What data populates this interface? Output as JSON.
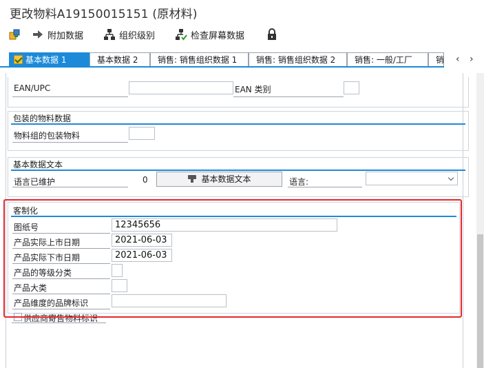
{
  "window": {
    "title": "更改物料A19150015151 (原材料)"
  },
  "toolbar": {
    "additional_data": "附加数据",
    "org_levels": "组织级别",
    "check_screen": "检查屏幕数据"
  },
  "tabs": [
    {
      "label": "基本数据 1"
    },
    {
      "label": "基本数据 2"
    },
    {
      "label": "销售: 销售组织数据 1"
    },
    {
      "label": "销售: 销售组织数据 2"
    },
    {
      "label": "销售: 一般/工厂"
    },
    {
      "label": "销"
    }
  ],
  "ean_section": {
    "ean_label": "EAN/UPC",
    "ean_value": "",
    "ean_category_label": "EAN 类别",
    "ean_category_value": ""
  },
  "packaging": {
    "title": "包装的物料数据",
    "group_label": "物料组的包装物料",
    "group_value": ""
  },
  "basic_text": {
    "title": "基本数据文本",
    "lang_maintained_label": "语言已维护",
    "lang_maintained_count": "0",
    "text_button": "基本数据文本",
    "language_label": "语言:",
    "language_value": ""
  },
  "custom": {
    "title": "客制化",
    "drawing_no_label": "图纸号",
    "drawing_no_value": "12345656",
    "launch_date_label": "产品实际上市日期",
    "launch_date_value": "2021-06-03",
    "delist_date_label": "产品实际下市日期",
    "delist_date_value": "2021-06-03",
    "grade_label": "产品的等级分类",
    "grade_value": "",
    "category_label": "产品大类",
    "category_value": "",
    "brand_label": "产品维度的品牌标识",
    "brand_value": "",
    "consignment_label": "供应商寄售物料标识"
  },
  "colors": {
    "accent": "#1c8ad9",
    "highlight": "#e3272c"
  }
}
